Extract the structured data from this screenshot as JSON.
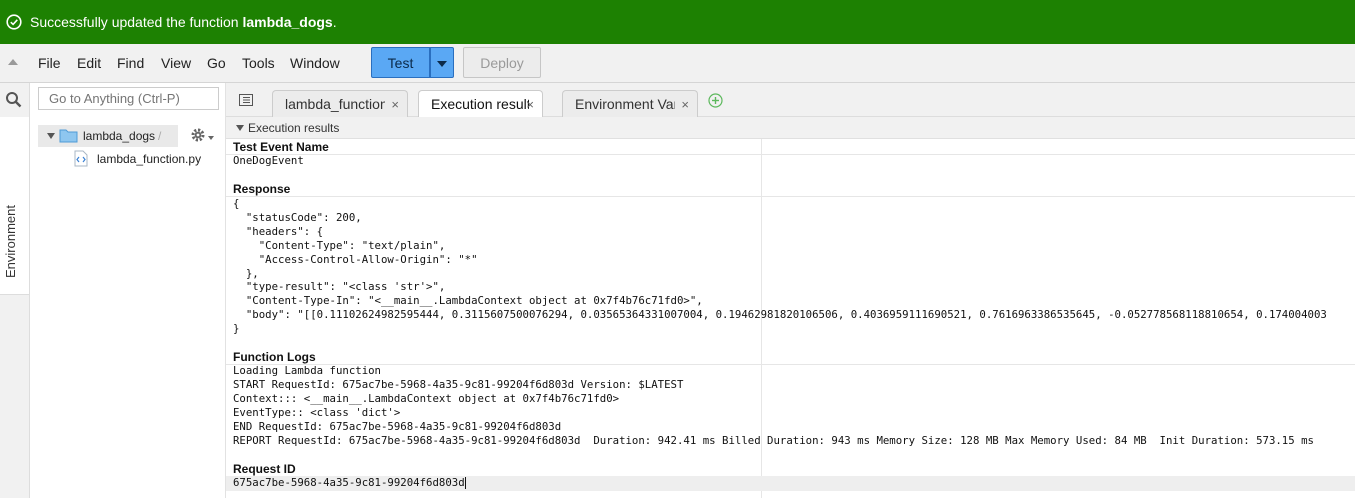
{
  "banner": {
    "message_prefix": "Successfully updated the function ",
    "function_name": "lambda_dogs",
    "message_suffix": ".",
    "color": "#1d8102"
  },
  "menu": {
    "items": [
      "File",
      "Edit",
      "Find",
      "View",
      "Go",
      "Tools",
      "Window"
    ],
    "test_label": "Test",
    "deploy_label": "Deploy"
  },
  "sidebar": {
    "goto_placeholder": "Go to Anything (Ctrl-P)",
    "environment_label": "Environment",
    "folder": "lambda_dogs",
    "folder_slash": "/",
    "file": "lambda_function.py"
  },
  "tabs": [
    {
      "label": "lambda_function",
      "close": "×"
    },
    {
      "label": "Execution results",
      "close": "×"
    },
    {
      "label": "Environment Variables",
      "close": "×"
    }
  ],
  "results": {
    "header": "Execution results",
    "test_event_title": "Test Event Name",
    "test_event_name": "OneDogEvent",
    "response_title": "Response",
    "response_lines": [
      "{",
      "  \"statusCode\": 200,",
      "  \"headers\": {",
      "    \"Content-Type\": \"text/plain\",",
      "    \"Access-Control-Allow-Origin\": \"*\"",
      "  },",
      "  \"type-result\": \"<class 'str'>\",",
      "  \"Content-Type-In\": \"<__main__.LambdaContext object at 0x7f4b76c71fd0>\",",
      "  \"body\": \"[[0.11102624982595444, 0.3115607500076294, 0.03565364331007004, 0.19462981820106506, 0.4036959111690521, 0.7616963386535645, -0.052778568118810654, 0.174004003",
      "}"
    ],
    "logs_title": "Function Logs",
    "log_lines": [
      "Loading Lambda function",
      "START RequestId: 675ac7be-5968-4a35-9c81-99204f6d803d Version: $LATEST",
      "Context::: <__main__.LambdaContext object at 0x7f4b76c71fd0>",
      "EventType:: <class 'dict'>",
      "END RequestId: 675ac7be-5968-4a35-9c81-99204f6d803d",
      "REPORT RequestId: 675ac7be-5968-4a35-9c81-99204f6d803d  Duration: 942.41 ms Billed Duration: 943 ms Memory Size: 128 MB Max Memory Used: 84 MB  Init Duration: 573.15 ms"
    ],
    "request_id_title": "Request ID",
    "request_id": "675ac7be-5968-4a35-9c81-99204f6d803d"
  }
}
